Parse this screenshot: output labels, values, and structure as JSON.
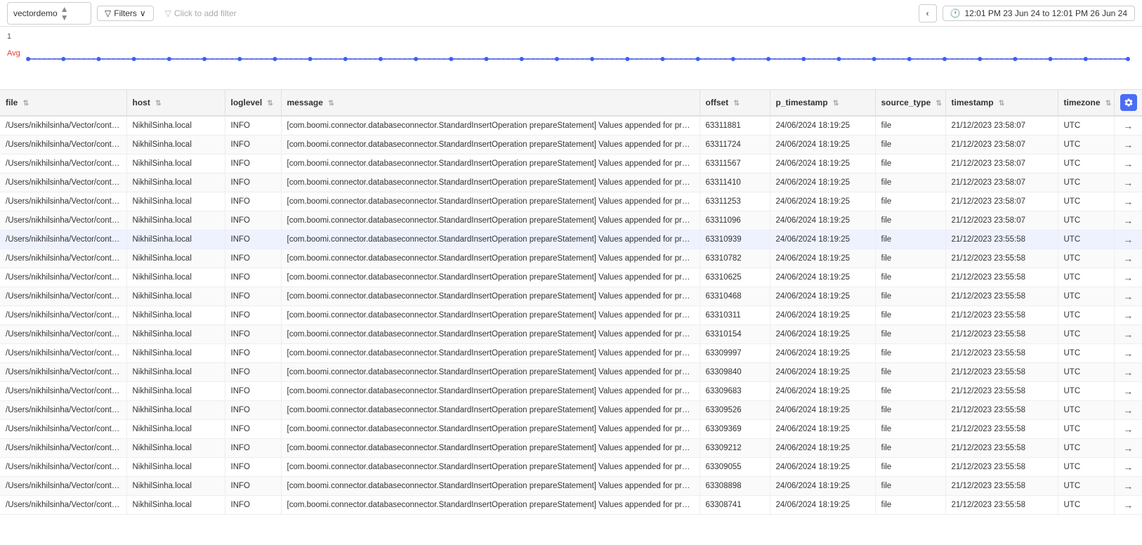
{
  "topbar": {
    "datasource": "vectordemo",
    "filters_label": "Filters",
    "filter_placeholder": "Click to add filter",
    "nav_prev": "‹",
    "nav_next": "›",
    "time_range": "12:01 PM 23 Jun 24 to 12:01 PM 26 Jun 24",
    "clock_icon": "🕐"
  },
  "chart": {
    "y_value": "1",
    "avg_label": "Avg"
  },
  "table": {
    "columns": [
      {
        "key": "file",
        "label": "file"
      },
      {
        "key": "host",
        "label": "host"
      },
      {
        "key": "loglevel",
        "label": "loglevel"
      },
      {
        "key": "message",
        "label": "message"
      },
      {
        "key": "offset",
        "label": "offset"
      },
      {
        "key": "p_timestamp",
        "label": "p_timestamp"
      },
      {
        "key": "source_type",
        "label": "source_type"
      },
      {
        "key": "timestamp",
        "label": "timestamp"
      },
      {
        "key": "timezone",
        "label": "timezone"
      },
      {
        "key": "action",
        "label": ""
      }
    ],
    "rows": [
      {
        "file": "/Users/nikhilsinha/Vector/container.log",
        "host": "NikhilSinha.local",
        "loglevel": "INFO",
        "message": "[com.boomi.connector.databaseconnector.StandardInsertOperation prepareStatement] Values appended for prepared statement",
        "offset": "63311881",
        "p_timestamp": "24/06/2024 18:19:25",
        "source_type": "file",
        "timestamp": "21/12/2023 23:58:07",
        "timezone": "UTC"
      },
      {
        "file": "/Users/nikhilsinha/Vector/container.log",
        "host": "NikhilSinha.local",
        "loglevel": "INFO",
        "message": "[com.boomi.connector.databaseconnector.StandardInsertOperation prepareStatement] Values appended for prepared statement",
        "offset": "63311724",
        "p_timestamp": "24/06/2024 18:19:25",
        "source_type": "file",
        "timestamp": "21/12/2023 23:58:07",
        "timezone": "UTC"
      },
      {
        "file": "/Users/nikhilsinha/Vector/container.log",
        "host": "NikhilSinha.local",
        "loglevel": "INFO",
        "message": "[com.boomi.connector.databaseconnector.StandardInsertOperation prepareStatement] Values appended for prepared statement",
        "offset": "63311567",
        "p_timestamp": "24/06/2024 18:19:25",
        "source_type": "file",
        "timestamp": "21/12/2023 23:58:07",
        "timezone": "UTC"
      },
      {
        "file": "/Users/nikhilsinha/Vector/container.log",
        "host": "NikhilSinha.local",
        "loglevel": "INFO",
        "message": "[com.boomi.connector.databaseconnector.StandardInsertOperation prepareStatement] Values appended for prepared statement",
        "offset": "63311410",
        "p_timestamp": "24/06/2024 18:19:25",
        "source_type": "file",
        "timestamp": "21/12/2023 23:58:07",
        "timezone": "UTC"
      },
      {
        "file": "/Users/nikhilsinha/Vector/container.log",
        "host": "NikhilSinha.local",
        "loglevel": "INFO",
        "message": "[com.boomi.connector.databaseconnector.StandardInsertOperation prepareStatement] Values appended for prepared statement",
        "offset": "63311253",
        "p_timestamp": "24/06/2024 18:19:25",
        "source_type": "file",
        "timestamp": "21/12/2023 23:58:07",
        "timezone": "UTC"
      },
      {
        "file": "/Users/nikhilsinha/Vector/container.log",
        "host": "NikhilSinha.local",
        "loglevel": "INFO",
        "message": "[com.boomi.connector.databaseconnector.StandardInsertOperation prepareStatement] Values appended for prepared statement",
        "offset": "63311096",
        "p_timestamp": "24/06/2024 18:19:25",
        "source_type": "file",
        "timestamp": "21/12/2023 23:58:07",
        "timezone": "UTC"
      },
      {
        "file": "/Users/nikhilsinha/Vector/container.log",
        "host": "NikhilSinha.local",
        "loglevel": "INFO",
        "message": "[com.boomi.connector.databaseconnector.StandardInsertOperation prepareStatement] Values appended for prepared statement",
        "offset": "63310939",
        "p_timestamp": "24/06/2024 18:19:25",
        "source_type": "file",
        "timestamp": "21/12/2023 23:55:58",
        "timezone": "UTC",
        "highlighted": true
      },
      {
        "file": "/Users/nikhilsinha/Vector/container.log",
        "host": "NikhilSinha.local",
        "loglevel": "INFO",
        "message": "[com.boomi.connector.databaseconnector.StandardInsertOperation prepareStatement] Values appended for prepared statement",
        "offset": "63310782",
        "p_timestamp": "24/06/2024 18:19:25",
        "source_type": "file",
        "timestamp": "21/12/2023 23:55:58",
        "timezone": "UTC"
      },
      {
        "file": "/Users/nikhilsinha/Vector/container.log",
        "host": "NikhilSinha.local",
        "loglevel": "INFO",
        "message": "[com.boomi.connector.databaseconnector.StandardInsertOperation prepareStatement] Values appended for prepared statement",
        "offset": "63310625",
        "p_timestamp": "24/06/2024 18:19:25",
        "source_type": "file",
        "timestamp": "21/12/2023 23:55:58",
        "timezone": "UTC"
      },
      {
        "file": "/Users/nikhilsinha/Vector/container.log",
        "host": "NikhilSinha.local",
        "loglevel": "INFO",
        "message": "[com.boomi.connector.databaseconnector.StandardInsertOperation prepareStatement] Values appended for prepared statement",
        "offset": "63310468",
        "p_timestamp": "24/06/2024 18:19:25",
        "source_type": "file",
        "timestamp": "21/12/2023 23:55:58",
        "timezone": "UTC"
      },
      {
        "file": "/Users/nikhilsinha/Vector/container.log",
        "host": "NikhilSinha.local",
        "loglevel": "INFO",
        "message": "[com.boomi.connector.databaseconnector.StandardInsertOperation prepareStatement] Values appended for prepared statement",
        "offset": "63310311",
        "p_timestamp": "24/06/2024 18:19:25",
        "source_type": "file",
        "timestamp": "21/12/2023 23:55:58",
        "timezone": "UTC"
      },
      {
        "file": "/Users/nikhilsinha/Vector/container.log",
        "host": "NikhilSinha.local",
        "loglevel": "INFO",
        "message": "[com.boomi.connector.databaseconnector.StandardInsertOperation prepareStatement] Values appended for prepared statement",
        "offset": "63310154",
        "p_timestamp": "24/06/2024 18:19:25",
        "source_type": "file",
        "timestamp": "21/12/2023 23:55:58",
        "timezone": "UTC"
      },
      {
        "file": "/Users/nikhilsinha/Vector/container.log",
        "host": "NikhilSinha.local",
        "loglevel": "INFO",
        "message": "[com.boomi.connector.databaseconnector.StandardInsertOperation prepareStatement] Values appended for prepared statement",
        "offset": "63309997",
        "p_timestamp": "24/06/2024 18:19:25",
        "source_type": "file",
        "timestamp": "21/12/2023 23:55:58",
        "timezone": "UTC"
      },
      {
        "file": "/Users/nikhilsinha/Vector/container.log",
        "host": "NikhilSinha.local",
        "loglevel": "INFO",
        "message": "[com.boomi.connector.databaseconnector.StandardInsertOperation prepareStatement] Values appended for prepared statement",
        "offset": "63309840",
        "p_timestamp": "24/06/2024 18:19:25",
        "source_type": "file",
        "timestamp": "21/12/2023 23:55:58",
        "timezone": "UTC"
      },
      {
        "file": "/Users/nikhilsinha/Vector/container.log",
        "host": "NikhilSinha.local",
        "loglevel": "INFO",
        "message": "[com.boomi.connector.databaseconnector.StandardInsertOperation prepareStatement] Values appended for prepared statement",
        "offset": "63309683",
        "p_timestamp": "24/06/2024 18:19:25",
        "source_type": "file",
        "timestamp": "21/12/2023 23:55:58",
        "timezone": "UTC"
      },
      {
        "file": "/Users/nikhilsinha/Vector/container.log",
        "host": "NikhilSinha.local",
        "loglevel": "INFO",
        "message": "[com.boomi.connector.databaseconnector.StandardInsertOperation prepareStatement] Values appended for prepared statement",
        "offset": "63309526",
        "p_timestamp": "24/06/2024 18:19:25",
        "source_type": "file",
        "timestamp": "21/12/2023 23:55:58",
        "timezone": "UTC"
      },
      {
        "file": "/Users/nikhilsinha/Vector/container.log",
        "host": "NikhilSinha.local",
        "loglevel": "INFO",
        "message": "[com.boomi.connector.databaseconnector.StandardInsertOperation prepareStatement] Values appended for prepared statement",
        "offset": "63309369",
        "p_timestamp": "24/06/2024 18:19:25",
        "source_type": "file",
        "timestamp": "21/12/2023 23:55:58",
        "timezone": "UTC"
      },
      {
        "file": "/Users/nikhilsinha/Vector/container.log",
        "host": "NikhilSinha.local",
        "loglevel": "INFO",
        "message": "[com.boomi.connector.databaseconnector.StandardInsertOperation prepareStatement] Values appended for prepared statement",
        "offset": "63309212",
        "p_timestamp": "24/06/2024 18:19:25",
        "source_type": "file",
        "timestamp": "21/12/2023 23:55:58",
        "timezone": "UTC"
      },
      {
        "file": "/Users/nikhilsinha/Vector/container.log",
        "host": "NikhilSinha.local",
        "loglevel": "INFO",
        "message": "[com.boomi.connector.databaseconnector.StandardInsertOperation prepareStatement] Values appended for prepared statement",
        "offset": "63309055",
        "p_timestamp": "24/06/2024 18:19:25",
        "source_type": "file",
        "timestamp": "21/12/2023 23:55:58",
        "timezone": "UTC"
      },
      {
        "file": "/Users/nikhilsinha/Vector/container.log",
        "host": "NikhilSinha.local",
        "loglevel": "INFO",
        "message": "[com.boomi.connector.databaseconnector.StandardInsertOperation prepareStatement] Values appended for prepared statement",
        "offset": "63308898",
        "p_timestamp": "24/06/2024 18:19:25",
        "source_type": "file",
        "timestamp": "21/12/2023 23:55:58",
        "timezone": "UTC"
      },
      {
        "file": "/Users/nikhilsinha/Vector/container.log",
        "host": "NikhilSinha.local",
        "loglevel": "INFO",
        "message": "[com.boomi.connector.databaseconnector.StandardInsertOperation prepareStatement] Values appended for prepared statement",
        "offset": "63308741",
        "p_timestamp": "24/06/2024 18:19:25",
        "source_type": "file",
        "timestamp": "21/12/2023 23:55:58",
        "timezone": "UTC"
      }
    ]
  }
}
